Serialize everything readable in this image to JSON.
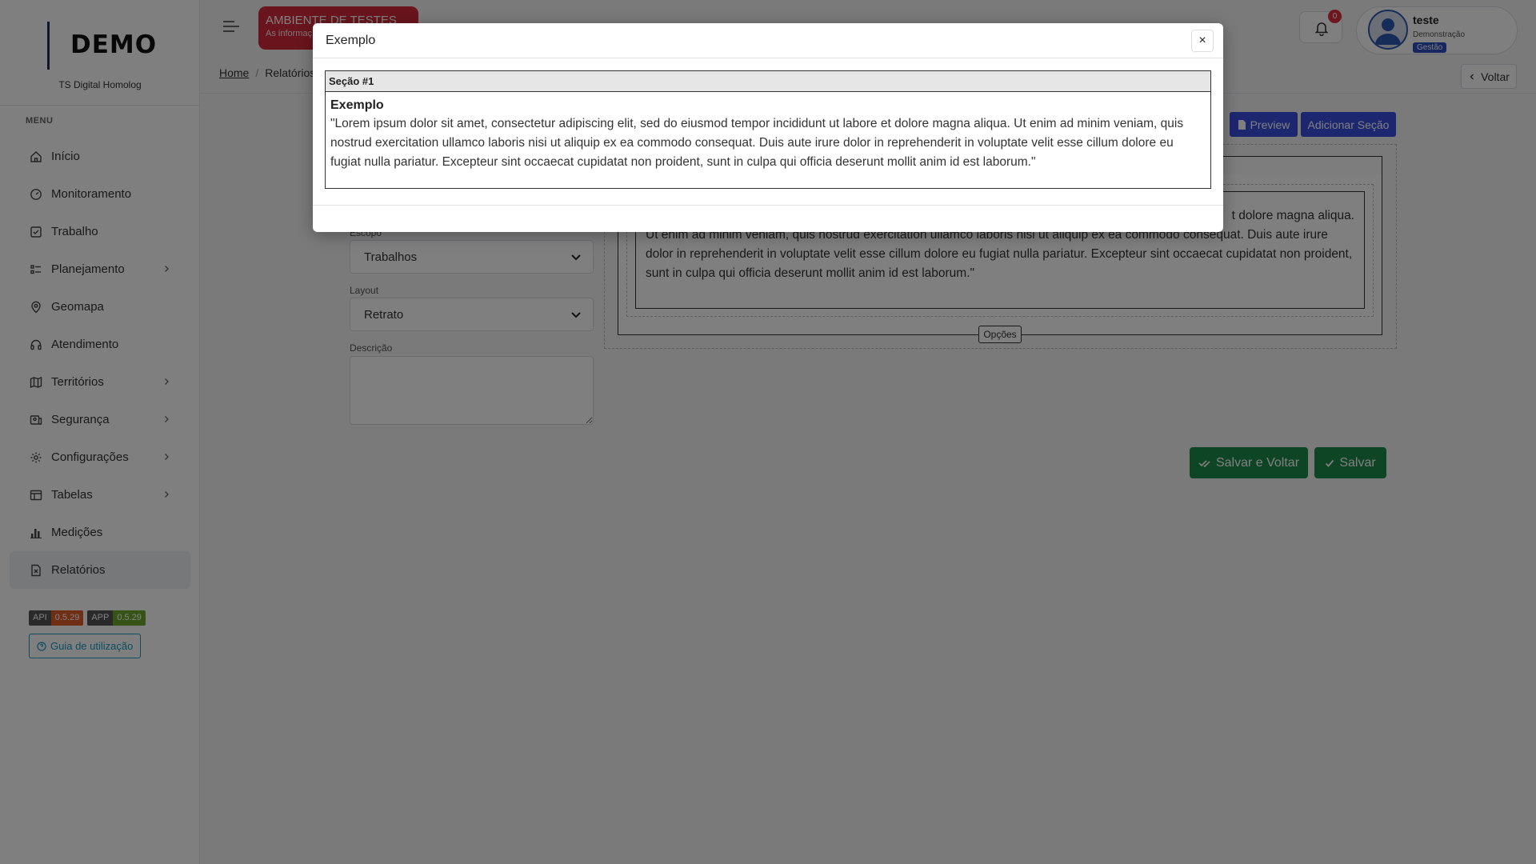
{
  "sidebar": {
    "brand": "DEMO",
    "subtitle": "TS Digital Homolog",
    "menu_title": "MENU",
    "items": [
      {
        "label": "Início",
        "icon": "home-icon",
        "has_children": false,
        "active": false
      },
      {
        "label": "Monitoramento",
        "icon": "gauge-icon",
        "has_children": false,
        "active": false
      },
      {
        "label": "Trabalho",
        "icon": "checkbox-icon",
        "has_children": false,
        "active": false
      },
      {
        "label": "Planejamento",
        "icon": "list-check-icon",
        "has_children": true,
        "active": false
      },
      {
        "label": "Geomapa",
        "icon": "map-pin-icon",
        "has_children": false,
        "active": false
      },
      {
        "label": "Atendimento",
        "icon": "headset-icon",
        "has_children": false,
        "active": false
      },
      {
        "label": "Territórios",
        "icon": "map-icon",
        "has_children": true,
        "active": false
      },
      {
        "label": "Segurança",
        "icon": "id-card-icon",
        "has_children": true,
        "active": false
      },
      {
        "label": "Configurações",
        "icon": "gear-icon",
        "has_children": true,
        "active": false
      },
      {
        "label": "Tabelas",
        "icon": "table-icon",
        "has_children": true,
        "active": false
      },
      {
        "label": "Medições",
        "icon": "bar-chart-icon",
        "has_children": false,
        "active": false
      },
      {
        "label": "Relatórios",
        "icon": "report-icon",
        "has_children": false,
        "active": true
      }
    ],
    "versions": {
      "api_label": "API",
      "api_version": "0.5.29",
      "app_label": "APP",
      "app_version": "0.5.29"
    },
    "guide_label": "Guia de utilização"
  },
  "topbar": {
    "env_title": "AMBIENTE DE TESTES",
    "env_subtitle": "As informaç",
    "notifications": "0",
    "user_name": "teste",
    "user_org": "Demonstração",
    "user_role": "Gestão"
  },
  "breadcrumb": {
    "home": "Home",
    "current": "Relatórios"
  },
  "back_label": "Voltar",
  "form": {
    "scope_label": "Escopo",
    "scope_value": "Trabalhos",
    "layout_label": "Layout",
    "layout_value": "Retrato",
    "description_label": "Descrição"
  },
  "preview": {
    "preview_label": "Preview",
    "add_section_label": "Adicionar Seção",
    "section_text_line1": "t dolore magna aliqua.",
    "section_text_rest": "Ut enim ad minim veniam, quis nostrud exercitation ullamco laboris nisi ut aliquip ex ea commodo consequat. Duis aute irure dolor in reprehenderit in voluptate velit esse cillum dolore eu fugiat nulla pariatur. Excepteur sint occaecat cupidatat non proident, sunt in culpa qui officia deserunt mollit anim id est laborum.\"",
    "options_label": "Opções"
  },
  "actions": {
    "save_back_label": "Salvar e Voltar",
    "save_label": "Salvar"
  },
  "colors": {
    "primary_blue": "#3b4fe0",
    "save_green": "#1d8a4a",
    "env_red": "#d52b3b"
  },
  "modal": {
    "title": "Exemplo",
    "close": "×",
    "section_header": "Seção #1",
    "section_title": "Exemplo",
    "section_text": "\"Lorem ipsum dolor sit amet, consectetur adipiscing elit, sed do eiusmod tempor incididunt ut labore et dolore magna aliqua. Ut enim ad minim veniam, quis nostrud exercitation ullamco laboris nisi ut aliquip ex ea commodo consequat. Duis aute irure dolor in reprehenderit in voluptate velit esse cillum dolore eu fugiat nulla pariatur. Excepteur sint occaecat cupidatat non proident, sunt in culpa qui officia deserunt mollit anim id est laborum.\""
  }
}
